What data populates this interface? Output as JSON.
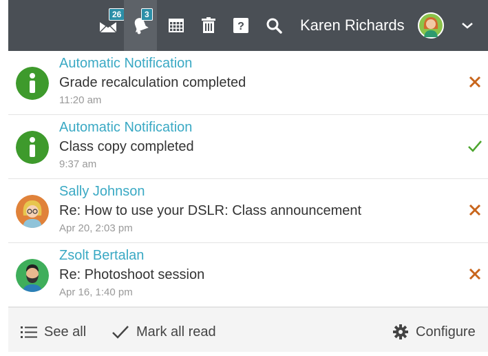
{
  "header": {
    "messages_count": "26",
    "notifications_count": "3",
    "user_name": "Karen Richards",
    "icons": [
      "mail-icon",
      "bell-icon",
      "calendar-icon",
      "trash-icon",
      "help-icon",
      "search-icon",
      "user-avatar",
      "chevron-down-icon"
    ]
  },
  "notifications": [
    {
      "from": "Automatic Notification",
      "subject": "Grade recalculation completed",
      "time": "11:20 am",
      "avatar": "info-icon",
      "action": "dismiss-icon"
    },
    {
      "from": "Automatic Notification",
      "subject": "Class copy completed",
      "time": "9:37 am",
      "avatar": "info-icon",
      "action": "check-icon"
    },
    {
      "from": "Sally Johnson",
      "subject": "Re: How to use your DSLR: Class announcement",
      "time": "Apr 20, 2:03 pm",
      "avatar": "user-avatar",
      "action": "dismiss-icon"
    },
    {
      "from": "Zsolt Bertalan",
      "subject": "Re: Photoshoot session",
      "time": "Apr 16, 1:40 pm",
      "avatar": "user-avatar",
      "action": "dismiss-icon"
    }
  ],
  "footer": {
    "see_all": "See all",
    "mark_all_read": "Mark all read",
    "configure": "Configure"
  },
  "colors": {
    "topbar": "#4a4f55",
    "link": "#3aa9c4",
    "info_green": "#3e9a2c",
    "dismiss": "#c8651b",
    "check": "#4ca52e",
    "badge": "#2c8fa8"
  }
}
